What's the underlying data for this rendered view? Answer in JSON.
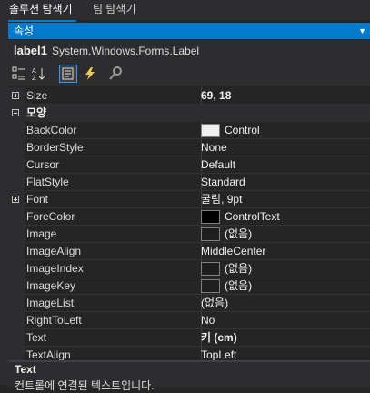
{
  "tabs": [
    "솔루션 탐색기",
    "팀 탐색기"
  ],
  "panel": {
    "title": "속성",
    "object_name": "label1",
    "object_type": "System.Windows.Forms.Label"
  },
  "toolbar_icons": [
    "categorized-icon",
    "alphabetical-icon",
    "properties-icon",
    "events-icon",
    "property-pages-icon"
  ],
  "rows": [
    {
      "kind": "prop",
      "name": "Size",
      "value": "69, 18",
      "bold": true,
      "expander": "plus"
    },
    {
      "kind": "cat",
      "name": "모양",
      "expander": "minus"
    },
    {
      "kind": "prop",
      "name": "BackColor",
      "value": "Control",
      "swatch": "#f0f0f0"
    },
    {
      "kind": "prop",
      "name": "BorderStyle",
      "value": "None"
    },
    {
      "kind": "prop",
      "name": "Cursor",
      "value": "Default"
    },
    {
      "kind": "prop",
      "name": "FlatStyle",
      "value": "Standard"
    },
    {
      "kind": "prop",
      "name": "Font",
      "value": "굴림, 9pt",
      "expander": "plus"
    },
    {
      "kind": "prop",
      "name": "ForeColor",
      "value": "ControlText",
      "swatch": "#000000"
    },
    {
      "kind": "prop",
      "name": "Image",
      "value": "(없음)",
      "swatch": "#1e1e1e"
    },
    {
      "kind": "prop",
      "name": "ImageAlign",
      "value": "MiddleCenter"
    },
    {
      "kind": "prop",
      "name": "ImageIndex",
      "value": "(없음)",
      "swatch": "#1e1e1e"
    },
    {
      "kind": "prop",
      "name": "ImageKey",
      "value": "(없음)",
      "swatch": "#1e1e1e"
    },
    {
      "kind": "prop",
      "name": "ImageList",
      "value": "(없음)"
    },
    {
      "kind": "prop",
      "name": "RightToLeft",
      "value": "No"
    },
    {
      "kind": "prop",
      "name": "Text",
      "value": "키 (cm)",
      "bold": true
    },
    {
      "kind": "prop",
      "name": "TextAlign",
      "value": "TopLeft"
    }
  ],
  "description": {
    "title": "Text",
    "text": "컨트롤에 연결된 텍스트입니다."
  }
}
